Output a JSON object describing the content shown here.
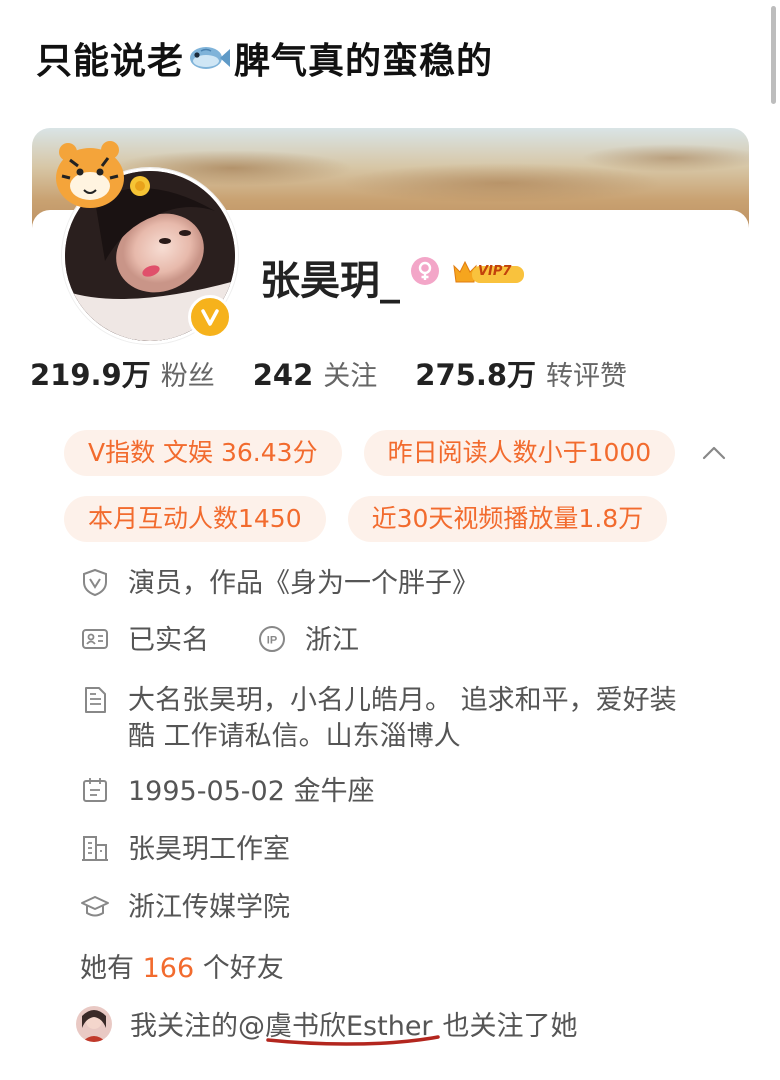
{
  "post": {
    "title_before": "只能说老",
    "title_after": "脾气真的蛮稳的",
    "fish_icon": "fish-emoji"
  },
  "profile": {
    "username": "张昊玥_",
    "gender": "female",
    "vip_label": "VIP7",
    "verified": true
  },
  "stats": [
    {
      "value": "219.9万",
      "label": "粉丝"
    },
    {
      "value": "242",
      "label": "关注"
    },
    {
      "value": "275.8万",
      "label": "转评赞"
    }
  ],
  "tags": {
    "row1": [
      "V指数 文娱 36.43分",
      "昨日阅读人数小于1000"
    ],
    "row2": [
      "本月互动人数1450",
      "近30天视频播放量1.8万"
    ]
  },
  "info": {
    "verification": "演员，作品《身为一个胖子》",
    "real_name": "已实名",
    "ip_label": "浙江",
    "bio": "大名张昊玥，小名儿皓月。  追求和平，爱好装酷  工作请私信。山东淄博人",
    "birthday": "1995-05-02 金牛座",
    "company": "张昊玥工作室",
    "school": "浙江传媒学院"
  },
  "friends": {
    "prefix": "她有",
    "count": "166",
    "suffix": "个好友"
  },
  "mutual": {
    "prefix": "我关注的",
    "name": "@虞书欣Esther",
    "suffix": "也关注了她"
  },
  "colors": {
    "accent": "#f26b2e",
    "tag_bg": "#fdf1ea",
    "badge": "#f6b21c",
    "underline": "#b3261e"
  }
}
